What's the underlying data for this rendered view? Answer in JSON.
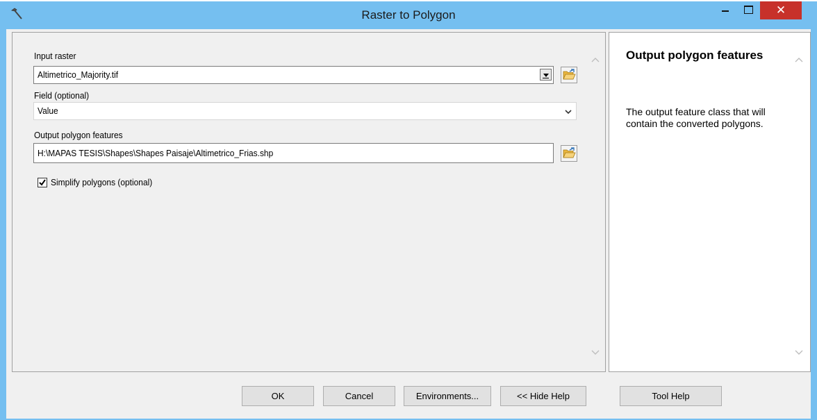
{
  "window": {
    "title": "Raster to Polygon",
    "close_glyph": "✕"
  },
  "form": {
    "input_raster_label": "Input raster",
    "input_raster_value": "Altimetrico_Majority.tif",
    "field_label": "Field (optional)",
    "field_value": "Value",
    "output_label": "Output polygon features",
    "output_value": "H:\\MAPAS TESIS\\Shapes\\Shapes Paisaje\\Altimetrico_Frias.shp",
    "simplify_label": "Simplify polygons (optional)",
    "simplify_checked": true
  },
  "help": {
    "title": "Output polygon features",
    "body": "The output feature class that will contain the converted polygons."
  },
  "buttons": {
    "ok": "OK",
    "cancel": "Cancel",
    "environments": "Environments...",
    "hide_help": "<< Hide Help",
    "tool_help": "Tool Help"
  },
  "icons": {
    "app": "hammer-icon",
    "browse": "open-folder-icon",
    "scroll_up": "chevron-up-icon",
    "scroll_down": "chevron-down-icon"
  },
  "colors": {
    "title_bar": "#75bff0",
    "close_button": "#c7312a",
    "panel_bg": "#f0f0f0"
  }
}
